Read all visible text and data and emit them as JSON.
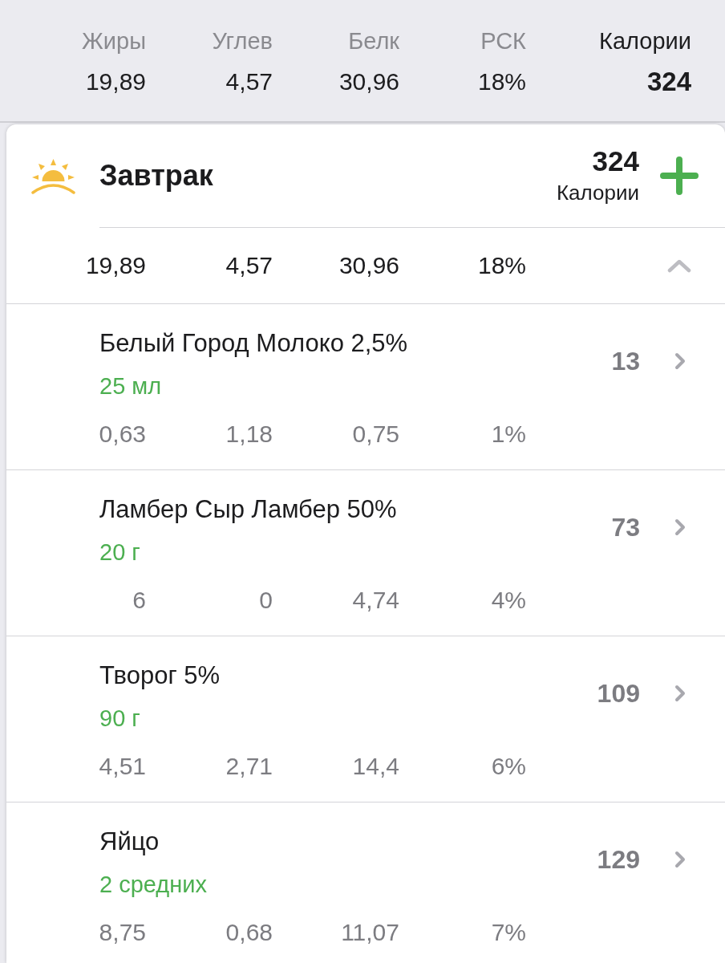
{
  "summary": {
    "columns": [
      {
        "kind": "macro",
        "label": "Жиры",
        "value": "19,89"
      },
      {
        "kind": "macro",
        "label": "Углев",
        "value": "4,57"
      },
      {
        "kind": "macro",
        "label": "Белк",
        "value": "30,96"
      },
      {
        "kind": "macro",
        "label": "РСК",
        "value": "18%"
      },
      {
        "kind": "total",
        "label": "Калории",
        "value": "324"
      }
    ]
  },
  "meal": {
    "title": "Завтрак",
    "calories": "324",
    "calories_label": "Калории",
    "expanded": true,
    "macros": [
      "19,89",
      "4,57",
      "30,96",
      "18%"
    ],
    "items": [
      {
        "name": "Белый Город Молоко 2,5%",
        "amount": "25 мл",
        "calories": "13",
        "macros": [
          "0,63",
          "1,18",
          "0,75",
          "1%"
        ]
      },
      {
        "name": "Ламбер Сыр Ламбер 50%",
        "amount": "20 г",
        "calories": "73",
        "macros": [
          "6",
          "0",
          "4,74",
          "4%"
        ]
      },
      {
        "name": "Творог 5%",
        "amount": "90 г",
        "calories": "109",
        "macros": [
          "4,51",
          "2,71",
          "14,4",
          "6%"
        ]
      },
      {
        "name": "Яйцо",
        "amount": "2 средних",
        "calories": "129",
        "macros": [
          "8,75",
          "0,68",
          "11,07",
          "7%"
        ]
      }
    ]
  }
}
